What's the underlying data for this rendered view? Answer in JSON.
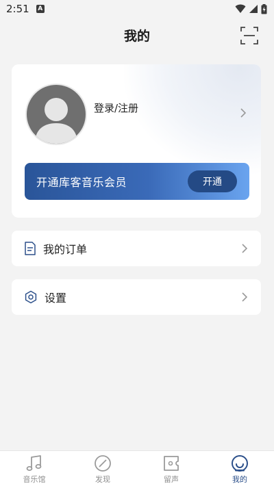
{
  "status_bar": {
    "time": "2:51",
    "notification_letter": "A"
  },
  "header": {
    "title": "我的"
  },
  "profile": {
    "login_label": "登录/注册"
  },
  "vip": {
    "text": "开通库客音乐会员",
    "button_label": "开通"
  },
  "menu": [
    {
      "label": "我的订单",
      "icon": "order-document-icon"
    },
    {
      "label": "设置",
      "icon": "settings-gear-icon"
    }
  ],
  "tabbar": {
    "items": [
      {
        "label": "音乐馆",
        "icon": "music-note-icon",
        "active": false
      },
      {
        "label": "发现",
        "icon": "compass-icon",
        "active": false
      },
      {
        "label": "留声",
        "icon": "record-icon",
        "active": false
      },
      {
        "label": "我的",
        "icon": "profile-face-icon",
        "active": true
      }
    ]
  },
  "colors": {
    "accent": "#2b4f8a",
    "vip_gradient_start": "#2a5599",
    "vip_gradient_end": "#6aa4ef",
    "background": "#f3f3f3"
  }
}
